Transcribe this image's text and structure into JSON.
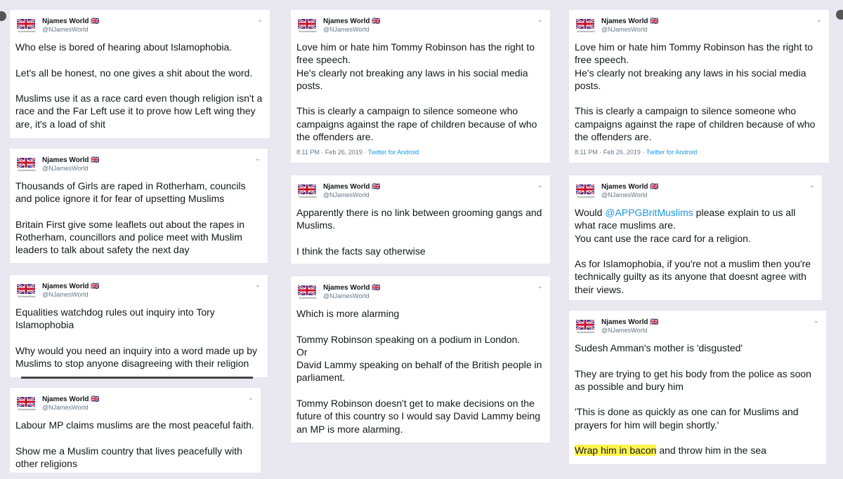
{
  "account": {
    "name": "Njames World",
    "flag": "🇬🇧",
    "handle": "@NJamesWorld",
    "logo_text": "NJamesWorld",
    "menu_glyph": "⌄"
  },
  "colors": {
    "link": "#1b95e0",
    "highlight": "#fff44f",
    "background": "#e9e8f1"
  },
  "tweets": [
    {
      "id": "t1",
      "text": "Who else is bored of hearing about Islamophobia.\n\nLet's all be honest, no one gives a shit about the word.\n\nMuslims use it as a race card even though religion isn't a race and the Far Left use it to prove how Left wing they are, it's a load of shit"
    },
    {
      "id": "t2",
      "text": "Thousands of Girls are raped in Rotherham, councils and police ignore it for fear of upsetting Muslims\n\nBritain First give some leaflets out about the rapes in Rotherham, councillors and police  meet with Muslim leaders to talk about safety the next day"
    },
    {
      "id": "t3",
      "text": "Equalities watchdog rules out inquiry into Tory Islamophobia\n\nWhy would you need an inquiry into a word made up by Muslims to stop anyone disagreeing with their religion"
    },
    {
      "id": "t4",
      "text": "Labour MP claims muslims are the most peaceful faith.\n\nShow me a Muslim country that lives peacefully with other religions"
    },
    {
      "id": "t5",
      "text": "Love him or hate him Tommy Robinson has the right to free speech.\nHe's clearly not breaking any laws in his social media posts.\n\nThis is clearly a campaign to silence someone who campaigns against the rape of children because of who the offenders are.",
      "time": "8:11 PM · Feb 26, 2019 · ",
      "source": "Twitter for Android"
    },
    {
      "id": "t6",
      "text": "Apparently there is no link between grooming gangs and Muslims.\n\nI think the facts say otherwise"
    },
    {
      "id": "t7",
      "text": "Which is more alarming\n\nTommy Robinson speaking on a podium in London.\nOr\nDavid Lammy speaking on behalf of the British people in parliament.\n\nTommy Robinson doesn't get to make decisions on the future of this country so I would say David Lammy being an MP is more alarming."
    },
    {
      "id": "t8",
      "text": "Love him or hate him Tommy Robinson has the right to free speech.\nHe's clearly not breaking any laws in his social media posts.\n\nThis is clearly a campaign to silence someone who campaigns against the rape of children because of who the offenders are.",
      "time": "8:11 PM · Feb 26, 2019 · ",
      "source": "Twitter for Android"
    },
    {
      "id": "t9",
      "pre": "Would ",
      "mention": "@APPGBritMuslims",
      "text": " please explain to us all what race muslims are.\nYou cant use the race card for a religion.\n\nAs for Islamophobia, if you're not a muslim then you're technically guilty as its anyone that doesnt agree with their views."
    },
    {
      "id": "t10",
      "text": "Sudesh Amman's mother is 'disgusted'\n\nThey are trying to get his body from the police as soon as possible and bury him\n\n'This is done as quickly as one can for Muslims and prayers for him will begin shortly.'\n\n",
      "highlight": "Wrap him in bacon",
      "tail": " and throw him in the sea"
    }
  ]
}
